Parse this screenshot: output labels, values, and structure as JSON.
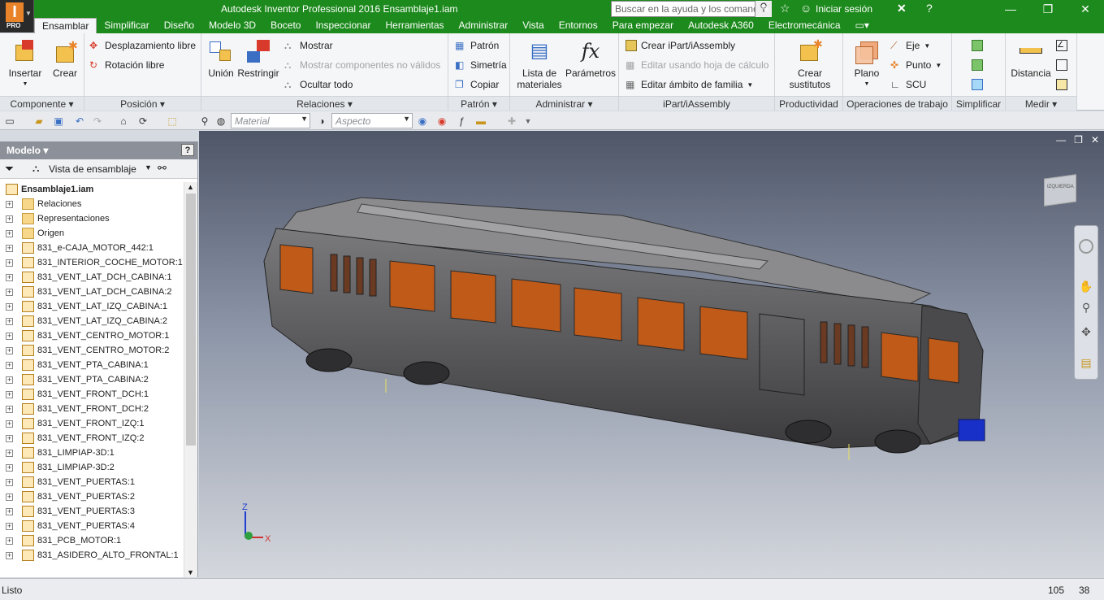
{
  "app": {
    "title": "Autodesk Inventor Professional 2016    Ensamblaje1.iam",
    "badge": "PRO",
    "logo_letter": "I"
  },
  "search": {
    "placeholder": "Buscar en la ayuda y los comandos..."
  },
  "signin": "Iniciar sesión",
  "tabs": [
    "Ensamblar",
    "Simplificar",
    "Diseño",
    "Modelo 3D",
    "Boceto",
    "Inspeccionar",
    "Herramientas",
    "Administrar",
    "Vista",
    "Entornos",
    "Para empezar",
    "Autodesk A360",
    "Electromecánica"
  ],
  "ribbon": {
    "componente": {
      "title": "Componente",
      "insertar": "Insertar",
      "crear": "Crear"
    },
    "posicion": {
      "title": "Posición",
      "despl": "Desplazamiento libre",
      "rot": "Rotación libre"
    },
    "relaciones": {
      "title": "Relaciones",
      "union": "Unión",
      "restringir": "Restringir",
      "mostrar": "Mostrar",
      "mostrar_inv": "Mostrar componentes no válidos",
      "ocultar": "Ocultar todo"
    },
    "patron": {
      "title": "Patrón",
      "patron": "Patrón",
      "simetria": "Simetría",
      "copiar": "Copiar"
    },
    "administrar": {
      "title": "Administrar",
      "lista1": "Lista de",
      "lista2": "materiales",
      "parametros": "Parámetros"
    },
    "ipart": {
      "title": "iPart/iAssembly",
      "crear": "Crear iPart/iAssembly",
      "editar": "Editar usando hoja de cálculo",
      "ambito": "Editar ámbito de familia"
    },
    "productividad": {
      "title": "Productividad",
      "crear1": "Crear",
      "crear2": "sustitutos"
    },
    "operaciones": {
      "title": "Operaciones de trabajo",
      "plano": "Plano",
      "eje": "Eje",
      "punto": "Punto",
      "scu": "SCU"
    },
    "simplificar": {
      "title": "Simplificar"
    },
    "medir": {
      "title": "Medir",
      "distancia": "Distancia"
    }
  },
  "qat": {
    "material": "Material",
    "aspecto": "Aspecto"
  },
  "browser": {
    "title": "Modelo",
    "view": "Vista de ensamblaje"
  },
  "tree": {
    "root": "Ensamblaje1.iam",
    "folders": [
      "Relaciones",
      "Representaciones",
      "Origen"
    ],
    "parts": [
      "831_e-CAJA_MOTOR_442:1",
      "831_INTERIOR_COCHE_MOTOR:1",
      "831_VENT_LAT_DCH_CABINA:1",
      "831_VENT_LAT_DCH_CABINA:2",
      "831_VENT_LAT_IZQ_CABINA:1",
      "831_VENT_LAT_IZQ_CABINA:2",
      "831_VENT_CENTRO_MOTOR:1",
      "831_VENT_CENTRO_MOTOR:2",
      "831_VENT_PTA_CABINA:1",
      "831_VENT_PTA_CABINA:2",
      "831_VENT_FRONT_DCH:1",
      "831_VENT_FRONT_DCH:2",
      "831_VENT_FRONT_IZQ:1",
      "831_VENT_FRONT_IZQ:2",
      "831_LIMPIAP-3D:1",
      "831_LIMPIAP-3D:2",
      "831_VENT_PUERTAS:1",
      "831_VENT_PUERTAS:2",
      "831_VENT_PUERTAS:3",
      "831_VENT_PUERTAS:4",
      "831_PCB_MOTOR:1",
      "831_ASIDERO_ALTO_FRONTAL:1"
    ]
  },
  "viewcube": {
    "label": "IZQUIERDA"
  },
  "axes": {
    "z": "Z",
    "x": "X"
  },
  "status": {
    "text": "Listo",
    "c1": "105",
    "c2": "38"
  },
  "colors": {
    "title_green": "#1d8a1d",
    "accent_orange": "#e8832a"
  }
}
